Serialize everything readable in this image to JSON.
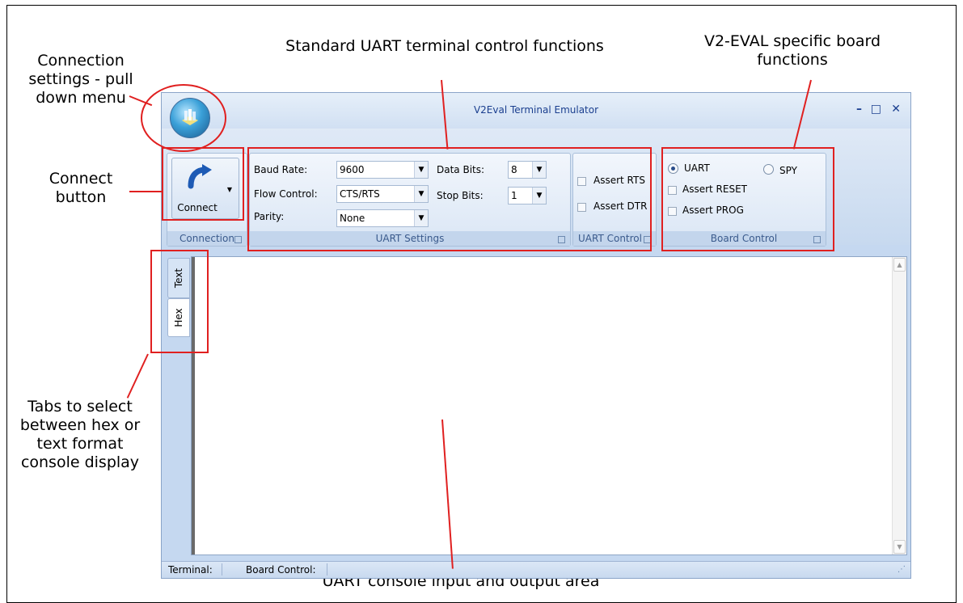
{
  "callouts": {
    "connection_menu": "Connection settings - pull down menu",
    "standard_functions": "Standard UART terminal control functions",
    "board_functions": "V2-EVAL specific board functions",
    "connect_button": "Connect button",
    "tabs": "Tabs to select between hex or text format console display",
    "console_area": "UART console input and output area"
  },
  "window": {
    "title": "V2Eval Terminal Emulator",
    "min_glyph": "–",
    "max_glyph": "□",
    "close_glyph": "✕",
    "app_orb_icon": "app-orb-icon"
  },
  "connection_group": {
    "label": "Connection",
    "connect_label": "Connect",
    "connect_icon": "redo-arrow-icon"
  },
  "uart_settings": {
    "label": "UART Settings",
    "baud_label": "Baud Rate:",
    "baud_value": "9600",
    "flow_label": "Flow Control:",
    "flow_value": "CTS/RTS",
    "parity_label": "Parity:",
    "parity_value": "None",
    "data_bits_label": "Data Bits:",
    "data_bits_value": "8",
    "stop_bits_label": "Stop Bits:",
    "stop_bits_value": "1"
  },
  "uart_control": {
    "label": "UART Control",
    "assert_rts": "Assert RTS",
    "assert_dtr": "Assert DTR"
  },
  "board_control": {
    "label": "Board Control",
    "uart_radio": "UART",
    "spy_radio": "SPY",
    "assert_reset": "Assert RESET",
    "assert_prog": "Assert PROG"
  },
  "tabs": [
    {
      "label": "Text"
    },
    {
      "label": "Hex"
    }
  ],
  "status": {
    "terminal": "Terminal:",
    "board_control": "Board Control:"
  },
  "colors": {
    "callout_red": "#e02020",
    "ribbon_blue": "#c5d8f0",
    "title_text": "#1b3f8f"
  }
}
